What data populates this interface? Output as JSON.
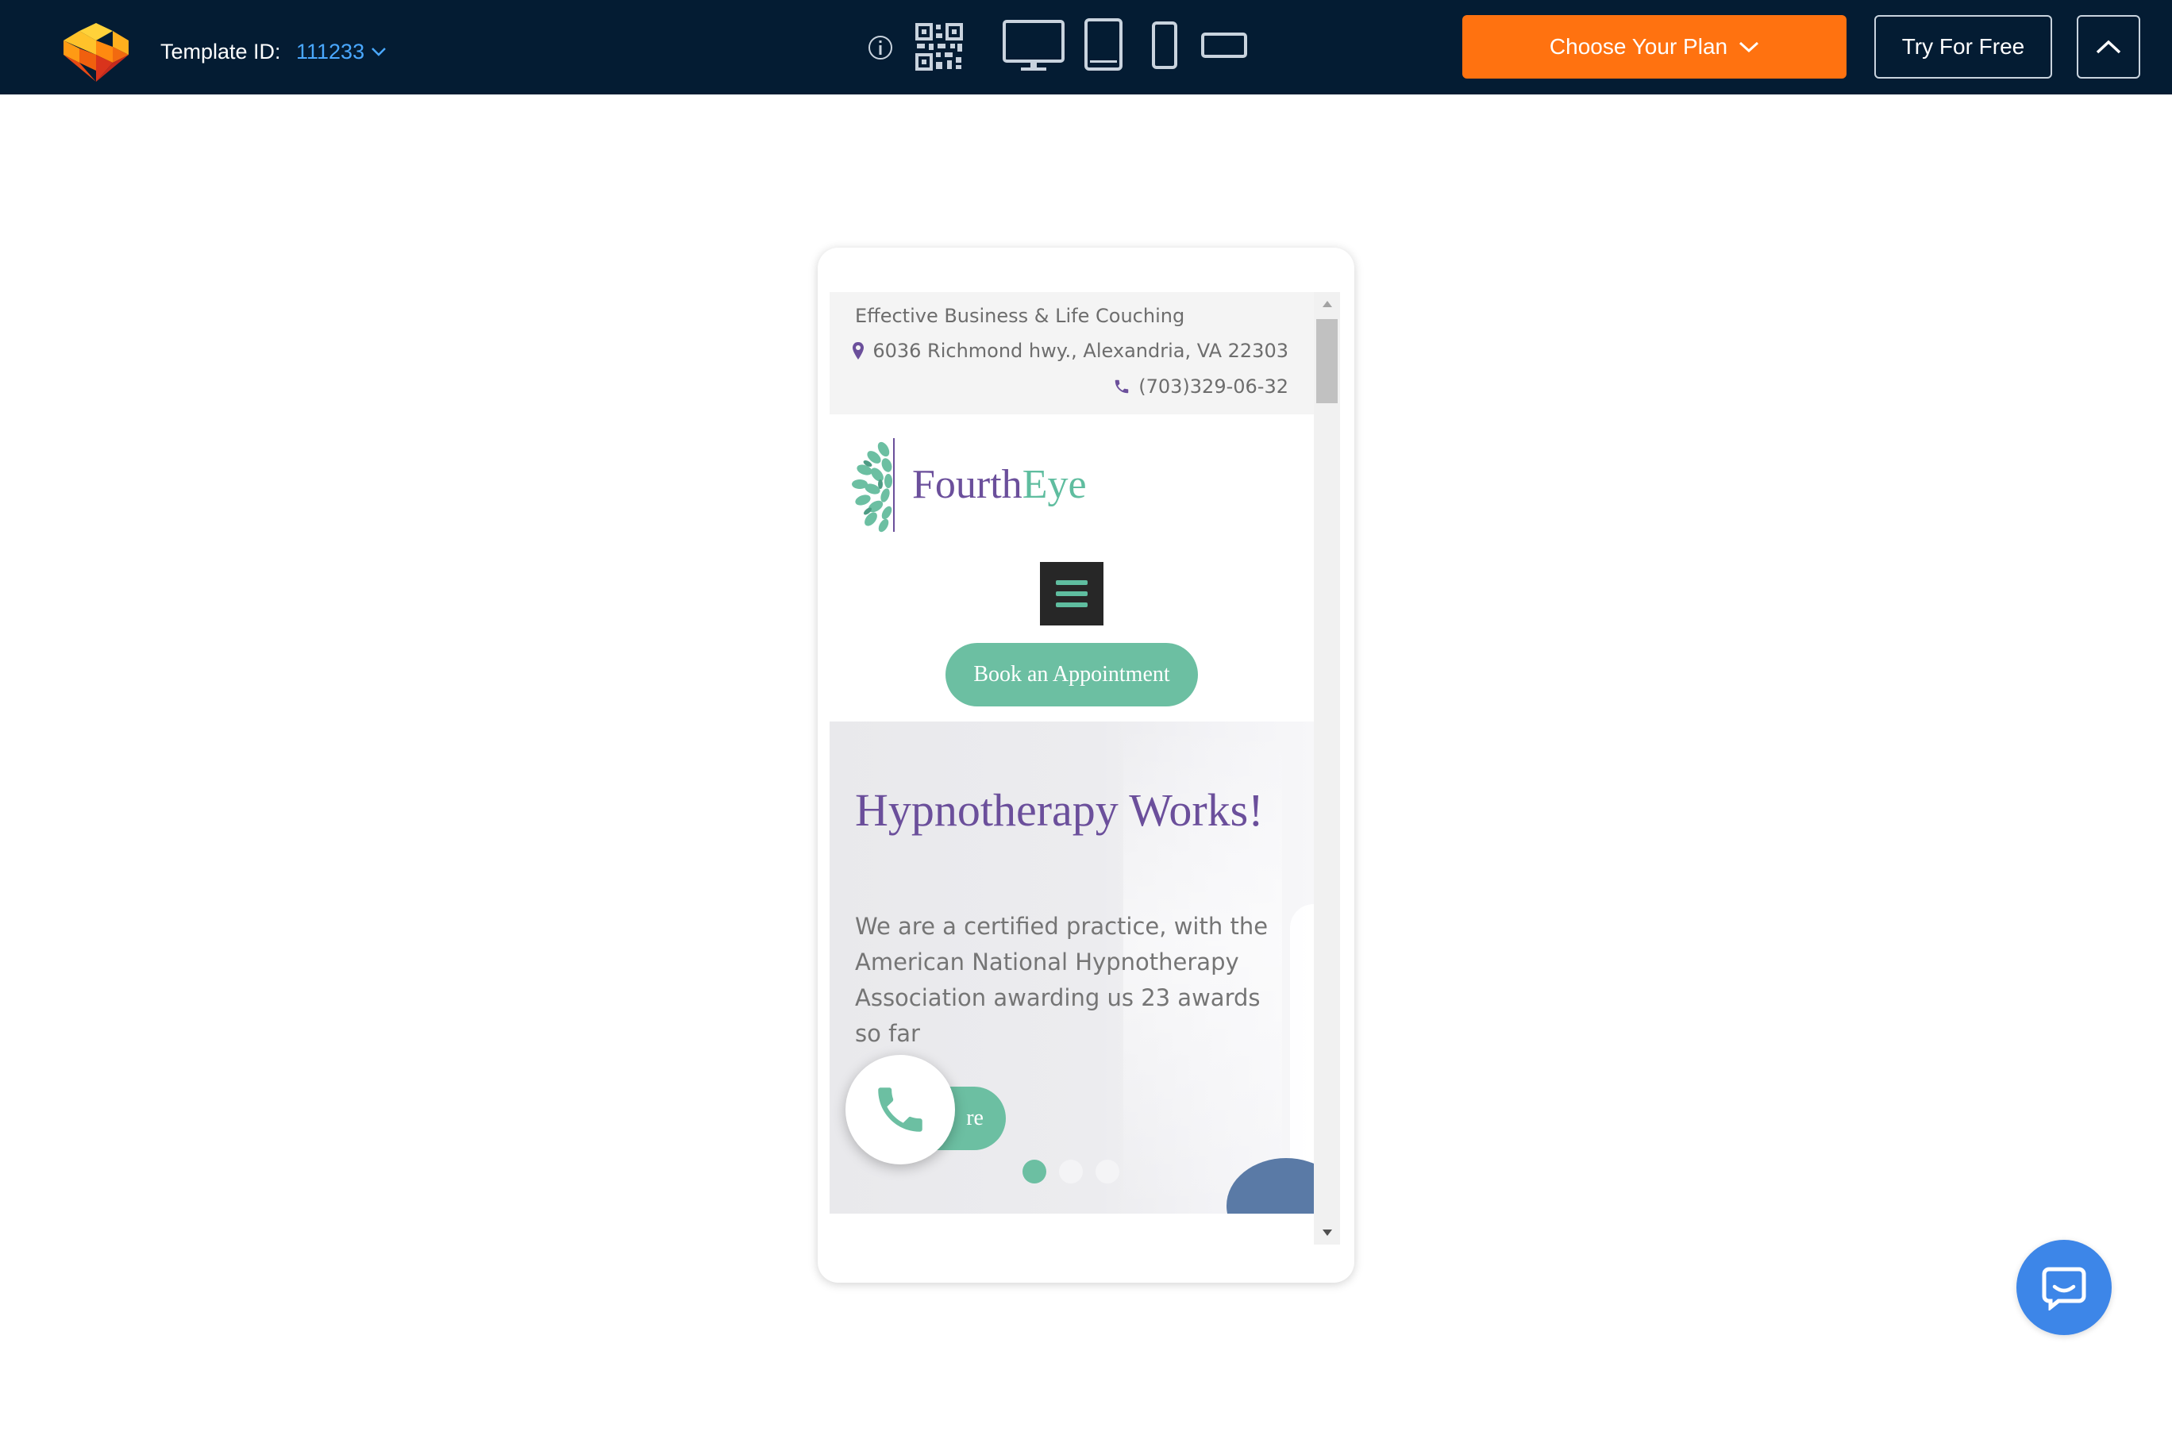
{
  "topbar": {
    "template_label": "Template ID:",
    "template_id": "111233",
    "plan_button": "Choose Your Plan",
    "try_button": "Try For Free"
  },
  "site": {
    "tagline": "Effective Business & Life Couching",
    "address": "6036 Richmond hwy., Alexandria, VA 22303",
    "phone": "(703)329-06-32",
    "brand_part1": "Fourth",
    "brand_part2": "Eye",
    "book_button": "Book an Appointment",
    "hero": {
      "title": "Hypnotherapy Works!",
      "text": "We are a certified practice, with the American National Hypnotherapy Association awarding us 23 awards so far",
      "button_visible_text": "re"
    },
    "slider_dots": 3,
    "active_dot": 1
  },
  "colors": {
    "topbar_bg": "#041c33",
    "accent_orange": "#ff7210",
    "template_id_blue": "#4aa8ff",
    "brand_purple": "#6b4f9b",
    "brand_green": "#6cbfa2",
    "chat_blue": "#3d86e8"
  },
  "icons": {
    "info": "info-icon",
    "qr": "qr-code-icon",
    "desktop": "desktop-icon",
    "tablet": "tablet-icon",
    "mobile": "mobile-icon",
    "landscape": "landscape-icon",
    "chevron_up": "chevron-up-icon",
    "chat": "chat-icon",
    "phone": "phone-icon",
    "map_pin": "map-pin-icon"
  }
}
